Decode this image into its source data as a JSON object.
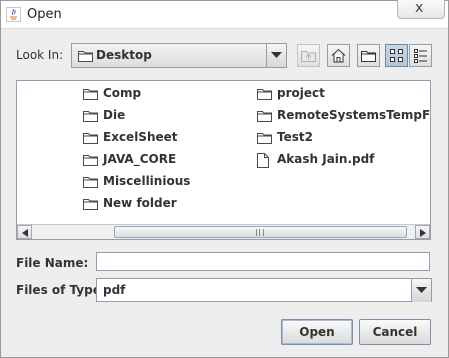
{
  "window": {
    "title": "Open",
    "close_glyph": "x"
  },
  "toolbar": {
    "look_in_label": "Look In:",
    "look_in_value": "Desktop",
    "buttons": [
      {
        "name": "up-one-level",
        "icon": "folder-up-icon",
        "enabled": false
      },
      {
        "name": "home",
        "icon": "home-icon",
        "enabled": true
      },
      {
        "name": "new-folder",
        "icon": "new-folder-icon",
        "enabled": true
      },
      {
        "name": "list-view",
        "icon": "list-view-icon",
        "enabled": true,
        "pressed": true
      },
      {
        "name": "details-view",
        "icon": "details-view-icon",
        "enabled": true
      }
    ]
  },
  "files": {
    "column1": [
      {
        "name": "Comp",
        "type": "folder"
      },
      {
        "name": "Die",
        "type": "folder"
      },
      {
        "name": "ExcelSheet",
        "type": "folder"
      },
      {
        "name": "JAVA_CORE",
        "type": "folder"
      },
      {
        "name": "Miscellinious",
        "type": "folder"
      },
      {
        "name": "New folder",
        "type": "folder"
      }
    ],
    "column2": [
      {
        "name": "project",
        "type": "folder"
      },
      {
        "name": "RemoteSystemsTempFiles",
        "type": "folder"
      },
      {
        "name": "Test2",
        "type": "folder"
      },
      {
        "name": "Akash Jain.pdf",
        "type": "file"
      }
    ]
  },
  "form": {
    "file_name_label": "File Name:",
    "file_name_value": "",
    "files_of_type_label": "Files of Type:",
    "files_of_type_value": "pdf"
  },
  "actions": {
    "open_label": "Open",
    "cancel_label": "Cancel"
  },
  "colors": {
    "border": "#8f9fb3",
    "background": "#eeeeee",
    "folder_stroke": "#4a4a4a"
  }
}
